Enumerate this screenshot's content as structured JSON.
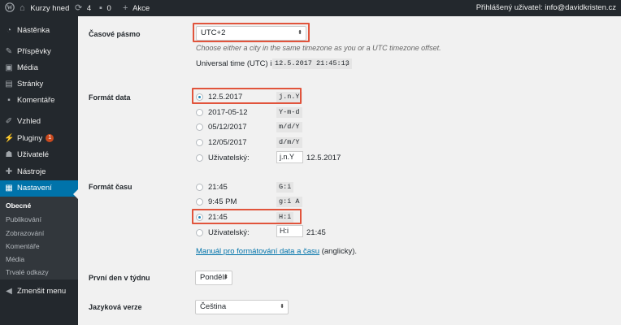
{
  "adminbar": {
    "site_name": "Kurzy hned",
    "updates_count": "4",
    "comments_count": "0",
    "new_label": "Akce",
    "user_text": "Přihlášený uživatel: info@davidkristen.cz"
  },
  "sidebar": {
    "items": [
      {
        "label": "Nástěnka",
        "icon": "dashboard-icon"
      },
      {
        "label": "Příspěvky",
        "icon": "pin-icon"
      },
      {
        "label": "Média",
        "icon": "media-icon"
      },
      {
        "label": "Stránky",
        "icon": "page-icon"
      },
      {
        "label": "Komentáře",
        "icon": "comment-icon"
      },
      {
        "label": "Vzhled",
        "icon": "brush-icon"
      },
      {
        "label": "Pluginy",
        "icon": "plugin-icon",
        "badge": "1"
      },
      {
        "label": "Uživatelé",
        "icon": "user-icon"
      },
      {
        "label": "Nástroje",
        "icon": "wrench-icon"
      },
      {
        "label": "Nastavení",
        "icon": "settings-icon"
      }
    ],
    "submenu": [
      "Obecné",
      "Publikování",
      "Zobrazování",
      "Komentáře",
      "Média",
      "Trvalé odkazy"
    ],
    "collapse_label": "Zmenšit menu"
  },
  "timezone": {
    "label": "Časové pásmo",
    "value": "UTC+2",
    "description": "Choose either a city in the same timezone as you or a UTC timezone offset.",
    "utc_prefix": "Universal time (UTC) is",
    "utc_value": "12.5.2017 21:45:13",
    "utc_suffix": "."
  },
  "date_format": {
    "label": "Formát data",
    "options": [
      {
        "display": "12.5.2017",
        "code": "j.n.Y"
      },
      {
        "display": "2017-05-12",
        "code": "Y-m-d"
      },
      {
        "display": "05/12/2017",
        "code": "m/d/Y"
      },
      {
        "display": "12/05/2017",
        "code": "d/m/Y"
      }
    ],
    "custom_label": "Uživatelský:",
    "custom_value": "j.n.Y",
    "custom_preview": "12.5.2017"
  },
  "time_format": {
    "label": "Formát času",
    "options": [
      {
        "display": "21:45",
        "code": "G:i"
      },
      {
        "display": "9:45 PM",
        "code": "g:i A"
      },
      {
        "display": "21:45",
        "code": "H:i"
      }
    ],
    "custom_label": "Uživatelský:",
    "custom_value": "H:i",
    "custom_preview": "21:45",
    "doc_link": "Manuál pro formátování data a času",
    "doc_suffix": " (anglicky)."
  },
  "week_start": {
    "label": "První den v týdnu",
    "value": "Pondělí"
  },
  "language": {
    "label": "Jazyková verze",
    "value": "Čeština"
  },
  "colors": {
    "highlight": "#e1543c",
    "accent": "#0073aa",
    "admin_dark": "#23282d"
  }
}
